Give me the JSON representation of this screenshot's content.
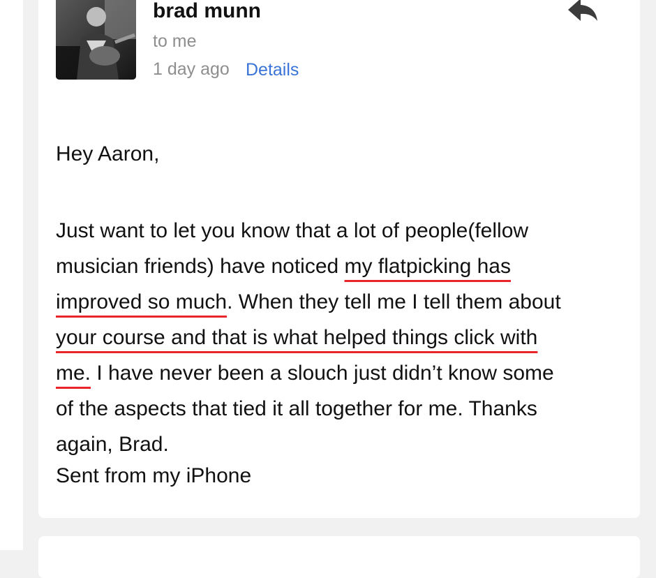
{
  "email": {
    "sender": "brad munn",
    "recipient": "to me",
    "time": "1 day ago",
    "details_link": "Details",
    "reply_icon": "reply-icon",
    "greeting": "Hey Aaron,",
    "body": {
      "l1": "Just want to let you know that a lot of people(fellow",
      "l2a": "musician friends) have noticed ",
      "l2b": "my flatpicking has ",
      "l3a": "improved so much",
      "l3b": ". When they tell me I tell them about",
      "l4a": "your course and that is what helped things click with",
      "l5a": "me.",
      "l5b": " I have never been a slouch just didn’t know some",
      "l6": "of the aspects that tied it all together for me. Thanks",
      "l7": "again, Brad."
    },
    "signature": "Sent from my iPhone",
    "highlight_color": "#e8252b",
    "link_color": "#3a74d8"
  }
}
